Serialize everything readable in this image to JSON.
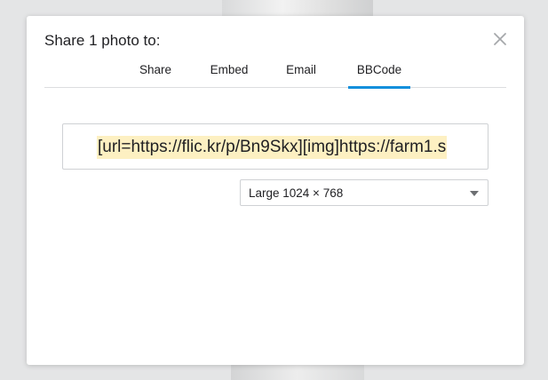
{
  "dialog": {
    "title": "Share 1 photo to:",
    "close_icon": "close-icon"
  },
  "tabs": [
    {
      "label": "Share",
      "active": false
    },
    {
      "label": "Embed",
      "active": false
    },
    {
      "label": "Email",
      "active": false
    },
    {
      "label": "BBCode",
      "active": true
    }
  ],
  "bbcode": {
    "value": "[url=https://flic.kr/p/Bn9Skx][img]https://farm1.s"
  },
  "size_select": {
    "selected": "Large 1024 × 768",
    "icon": "chevron-down-icon"
  },
  "colors": {
    "accent": "#128fdc",
    "highlight": "#fdf0c2",
    "border": "#cfd1d4"
  }
}
